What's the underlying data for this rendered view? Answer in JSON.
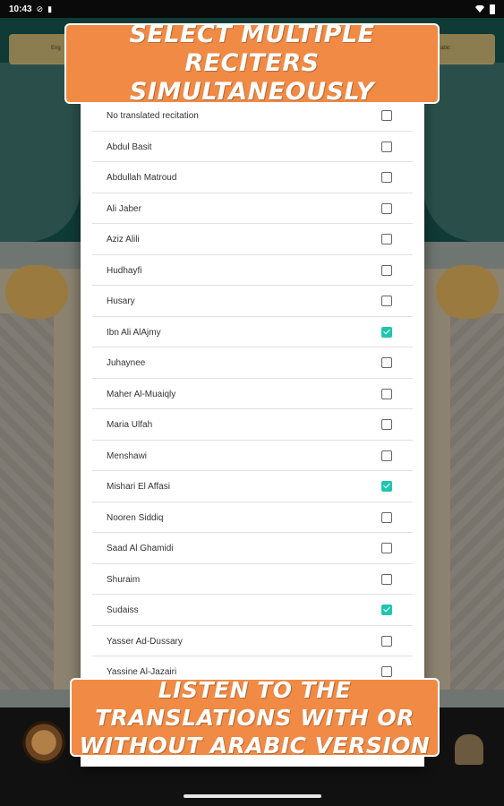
{
  "status_bar": {
    "time": "10:43"
  },
  "background": {
    "banner_left": "Eng",
    "banner_right": "Arabic"
  },
  "promo": {
    "top": "SELECT MULTIPLE RECITERS SIMULTANEOUSLY",
    "bottom": "LISTEN TO THE TRANSLATIONS WITH OR WITHOUT ARABIC VERSION"
  },
  "reciters": [
    {
      "label": "No translated recitation",
      "checked": false
    },
    {
      "label": "Abdul Basit",
      "checked": false
    },
    {
      "label": "Abdullah Matroud",
      "checked": false
    },
    {
      "label": "Ali Jaber",
      "checked": false
    },
    {
      "label": "Aziz Alili",
      "checked": false
    },
    {
      "label": "Hudhayfi",
      "checked": false
    },
    {
      "label": "Husary",
      "checked": false
    },
    {
      "label": "Ibn Ali AlAjmy",
      "checked": true
    },
    {
      "label": "Juhaynee",
      "checked": false
    },
    {
      "label": "Maher Al-Muaiqly",
      "checked": false
    },
    {
      "label": "Maria Ulfah",
      "checked": false
    },
    {
      "label": "Menshawi",
      "checked": false
    },
    {
      "label": "Mishari El Affasi",
      "checked": true
    },
    {
      "label": "Nooren Siddiq",
      "checked": false
    },
    {
      "label": "Saad Al Ghamidi",
      "checked": false
    },
    {
      "label": "Shuraim",
      "checked": false
    },
    {
      "label": "Sudaiss",
      "checked": true
    },
    {
      "label": "Yasser Ad-Dussary",
      "checked": false
    },
    {
      "label": "Yassine Al-Jazairi",
      "checked": false
    }
  ],
  "colors": {
    "accent": "#21c4b0",
    "banner": "#f08a44"
  }
}
